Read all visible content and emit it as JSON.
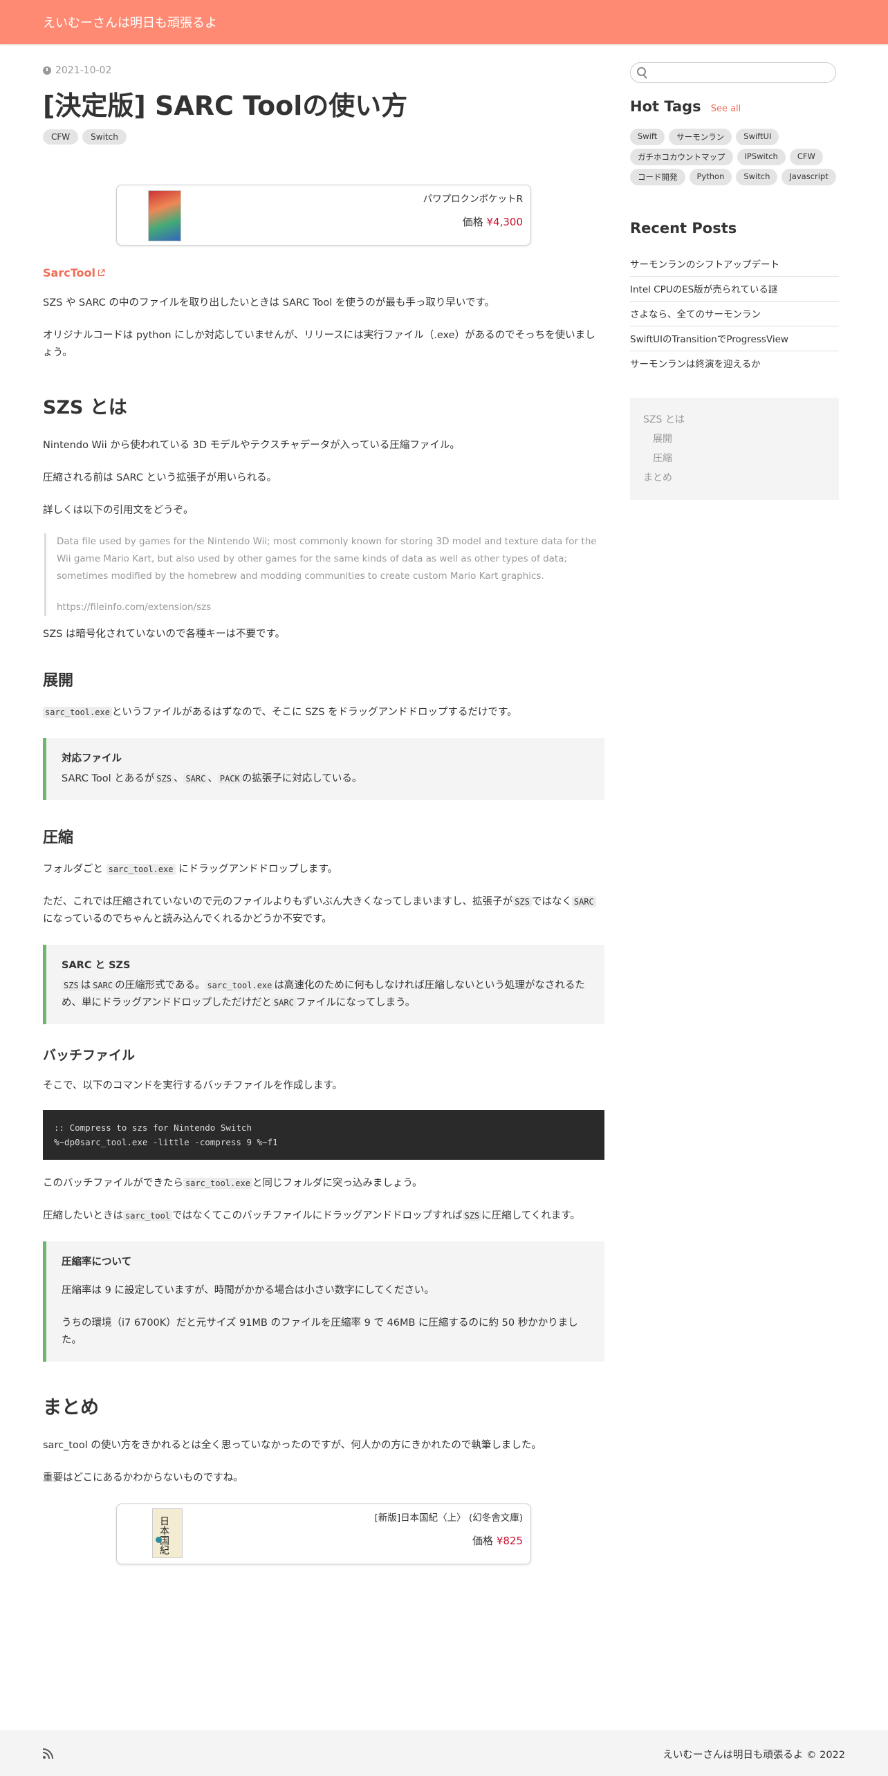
{
  "site": {
    "title": "えいむーさんは明日も頑張るよ"
  },
  "post": {
    "date": "2021-10-02",
    "title": "[決定版] SARC Toolの使い方",
    "tags": [
      "CFW",
      "Switch"
    ]
  },
  "product1": {
    "title": "パワプロクンポケットR",
    "price_label": "価格",
    "price": "¥4,300"
  },
  "link": {
    "label": "SarcTool"
  },
  "paras": {
    "p1": "SZS や SARC の中のファイルを取り出したいときは SARC Tool を使うのが最も手っ取り早いです。",
    "p2": "オリジナルコードは python にしか対応していませんが、リリースには実行ファイル（.exe）があるのでそっちを使いましょう。"
  },
  "szs": {
    "heading": "SZS とは",
    "p1": "Nintendo Wii から使われている 3D モデルやテクスチャデータが入っている圧縮ファイル。",
    "p2": "圧縮される前は SARC という拡張子が用いられる。",
    "p3": "詳しくは以下の引用文をどうぞ。",
    "quote": "Data file used by games for the Nintendo Wii; most commonly known for storing 3D model and texture data for the Wii game Mario Kart, but also used by other games for the same kinds of data as well as other types of data; sometimes modified by the homebrew and modding communities to create custom Mario Kart graphics.",
    "quote_src": "https://fileinfo.com/extension/szs",
    "p4": "SZS は暗号化されていないので各種キーは不要です。"
  },
  "expand": {
    "heading": "展開",
    "code1": "sarc_tool.exe",
    "p1_rest": "というファイルがあるはずなので、そこに SZS をドラッグアンドドロップするだけです。",
    "note_title": "対応ファイル",
    "note_pre": "SARC Tool とあるが",
    "note_c1": "SZS",
    "note_sep1": "、",
    "note_c2": "SARC",
    "note_sep2": "、",
    "note_c3": "PACK",
    "note_post": "の拡張子に対応している。"
  },
  "compress": {
    "heading": "圧縮",
    "p1_pre": "フォルダごと ",
    "p1_code": "sarc_tool.exe",
    "p1_post": " にドラッグアンドドロップします。",
    "p2_a": "ただ、これでは圧縮されていないので元のファイルよりもずいぶん大きくなってしまいますし、拡張子が",
    "p2_c1": "SZS",
    "p2_b": "ではなく",
    "p2_c2": "SARC",
    "p2_c": "になっているのでちゃんと読み込んでくれるかどうか不安です。",
    "note_title": "SARC と SZS",
    "note_c1": "SZS",
    "note_a": "は",
    "note_c2": "SARC",
    "note_b": "の圧縮形式である。",
    "note_c3": "sarc_tool.exe",
    "note_c": "は高速化のために何もしなければ圧縮しないという処理がなされるため、単にドラッグアンドドロップしただけだと",
    "note_c4": "SARC",
    "note_d": "ファイルになってしまう。"
  },
  "batch": {
    "heading": "バッチファイル",
    "p1": "そこで、以下のコマンドを実行するバッチファイルを作成します。",
    "code_line1": ":: Compress to szs for Nintendo Switch",
    "code_line2": "%~dp0sarc_tool.exe -little -compress 9 %~f1",
    "p2_a": "このバッチファイルができたら",
    "p2_code": "sarc_tool.exe",
    "p2_b": "と同じフォルダに突っ込みましょう。",
    "p3_a": "圧縮したいときは",
    "p3_c1": "sarc_tool",
    "p3_b": "ではなくてこのバッチファイルにドラッグアンドドロップすれば",
    "p3_c2": "SZS",
    "p3_c": "に圧縮してくれます。",
    "note_title": "圧縮率について",
    "note_p1": "圧縮率は 9 に設定していますが、時間がかかる場合は小さい数字にしてください。",
    "note_p2": "うちの環境（i7 6700K）だと元サイズ 91MB のファイルを圧縮率 9 で 46MB に圧縮するのに約 50 秒かかりました。"
  },
  "summary": {
    "heading": "まとめ",
    "p1": "sarc_tool の使い方をきかれるとは全く思っていなかったのですが、何人かの方にきかれたので執筆しました。",
    "p2": "重要はどこにあるかわからないものですね。"
  },
  "product2": {
    "title": "[新版]日本国紀〈上〉 (幻冬舎文庫)",
    "price_label": "価格",
    "price": "¥825",
    "cover_text": "日本国紀"
  },
  "sidebar": {
    "search_placeholder": "",
    "hot_tags_title": "Hot Tags",
    "see_all": "See all",
    "tags": [
      "Swift",
      "サーモンラン",
      "SwiftUI",
      "ガチホコカウントマップ",
      "IPSwitch",
      "CFW",
      "コード開発",
      "Python",
      "Switch",
      "Javascript"
    ],
    "recent_title": "Recent Posts",
    "recent": [
      "サーモンランのシフトアップデート",
      "Intel CPUのES版が売られている謎",
      "さよなら、全てのサーモンラン",
      "SwiftUIのTransitionでProgressView",
      "サーモンランは終演を迎えるか"
    ],
    "toc": [
      {
        "label": "SZS とは",
        "level": 1
      },
      {
        "label": "展開",
        "level": 2
      },
      {
        "label": "圧縮",
        "level": 2
      },
      {
        "label": "まとめ",
        "level": 1
      }
    ]
  },
  "footer": {
    "copyright": "えいむーさんは明日も頑張るよ © 2022"
  }
}
